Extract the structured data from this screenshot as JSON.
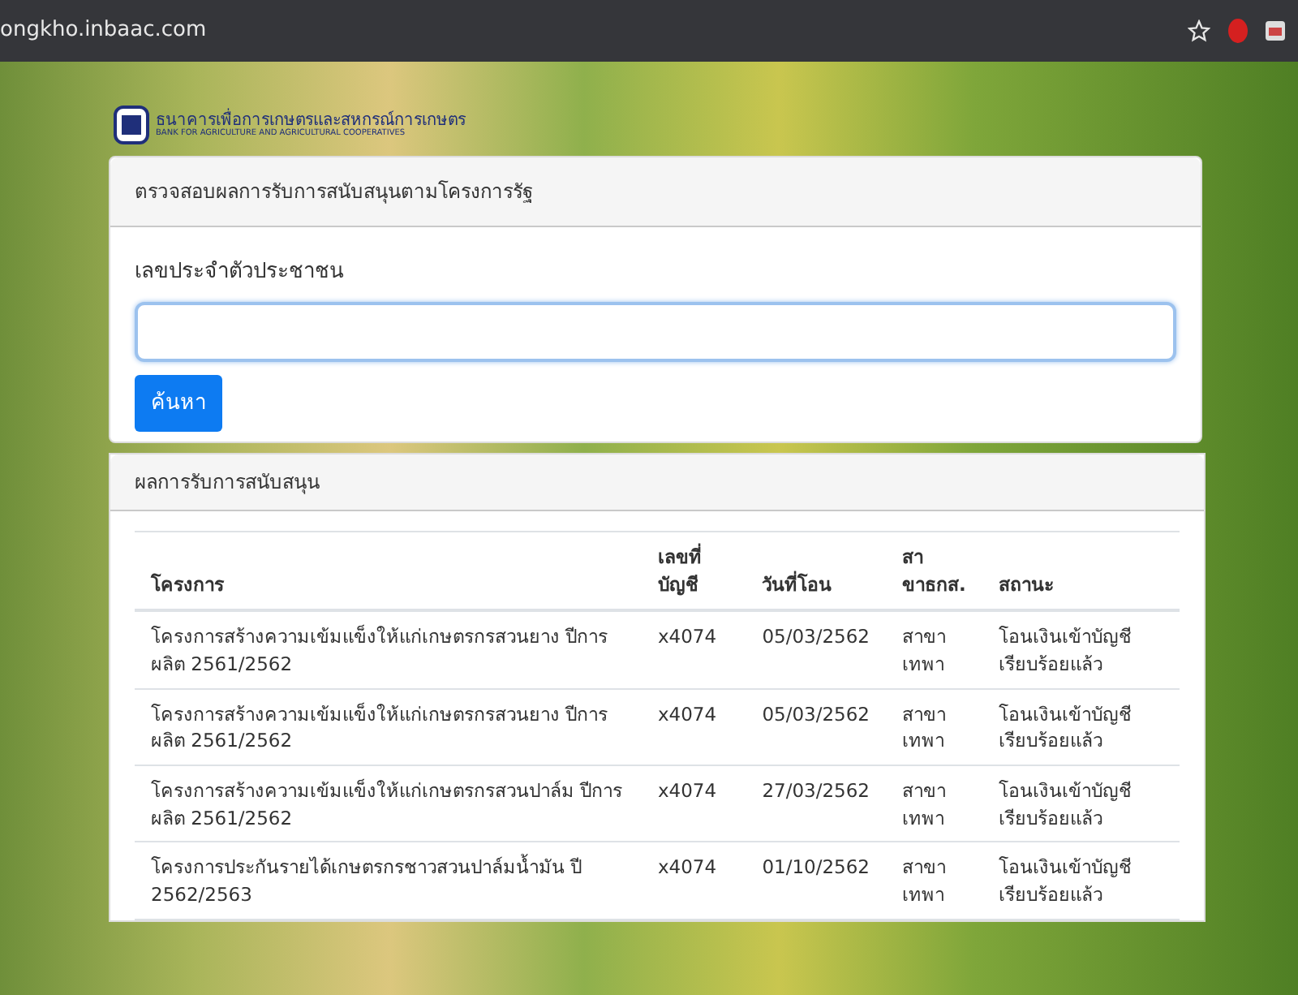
{
  "browser": {
    "url": "ongkho.inbaac.com"
  },
  "logo": {
    "name_th": "ธนาคารเพื่อการเกษตรและสหกรณ์การเกษตร",
    "name_en": "BANK FOR AGRICULTURE AND AGRICULTURAL COOPERATIVES"
  },
  "search_card": {
    "title": "ตรวจสอบผลการรับการสนับสนุนตามโครงการรัฐ",
    "field_label": "เลขประจำตัวประชาชน",
    "button": "ค้นหา"
  },
  "results_card": {
    "title": "ผลการรับการสนับสนุน",
    "table": {
      "columns": [
        "โครงการ",
        "เลขที่บัญชี",
        "วันที่โอน",
        "สาขาธกส.",
        "สถานะ"
      ],
      "rows": [
        [
          "โครงการสร้างความเข้มแข็งให้แก่เกษตรกรสวนยาง ปีการผลิต 2561/2562",
          "x4074",
          "05/03/2562",
          "สาขาเทพา",
          "โอนเงินเข้าบัญชีเรียบร้อยแล้ว"
        ],
        [
          "โครงการสร้างความเข้มแข็งให้แก่เกษตรกรสวนยาง ปีการผลิต 2561/2562",
          "x4074",
          "05/03/2562",
          "สาขาเทพา",
          "โอนเงินเข้าบัญชีเรียบร้อยแล้ว"
        ],
        [
          "โครงการสร้างความเข้มแข็งให้แก่เกษตรกรสวนปาล์ม ปีการผลิต 2561/2562",
          "x4074",
          "27/03/2562",
          "สาขาเทพา",
          "โอนเงินเข้าบัญชีเรียบร้อยแล้ว"
        ],
        [
          "โครงการประกันรายได้เกษตรกรชาวสวนปาล์มน้ำมัน ปี 2562/2563",
          "x4074",
          "01/10/2562",
          "สาขาเทพา",
          "โอนเงินเข้าบัญชีเรียบร้อยแล้ว"
        ]
      ]
    }
  }
}
